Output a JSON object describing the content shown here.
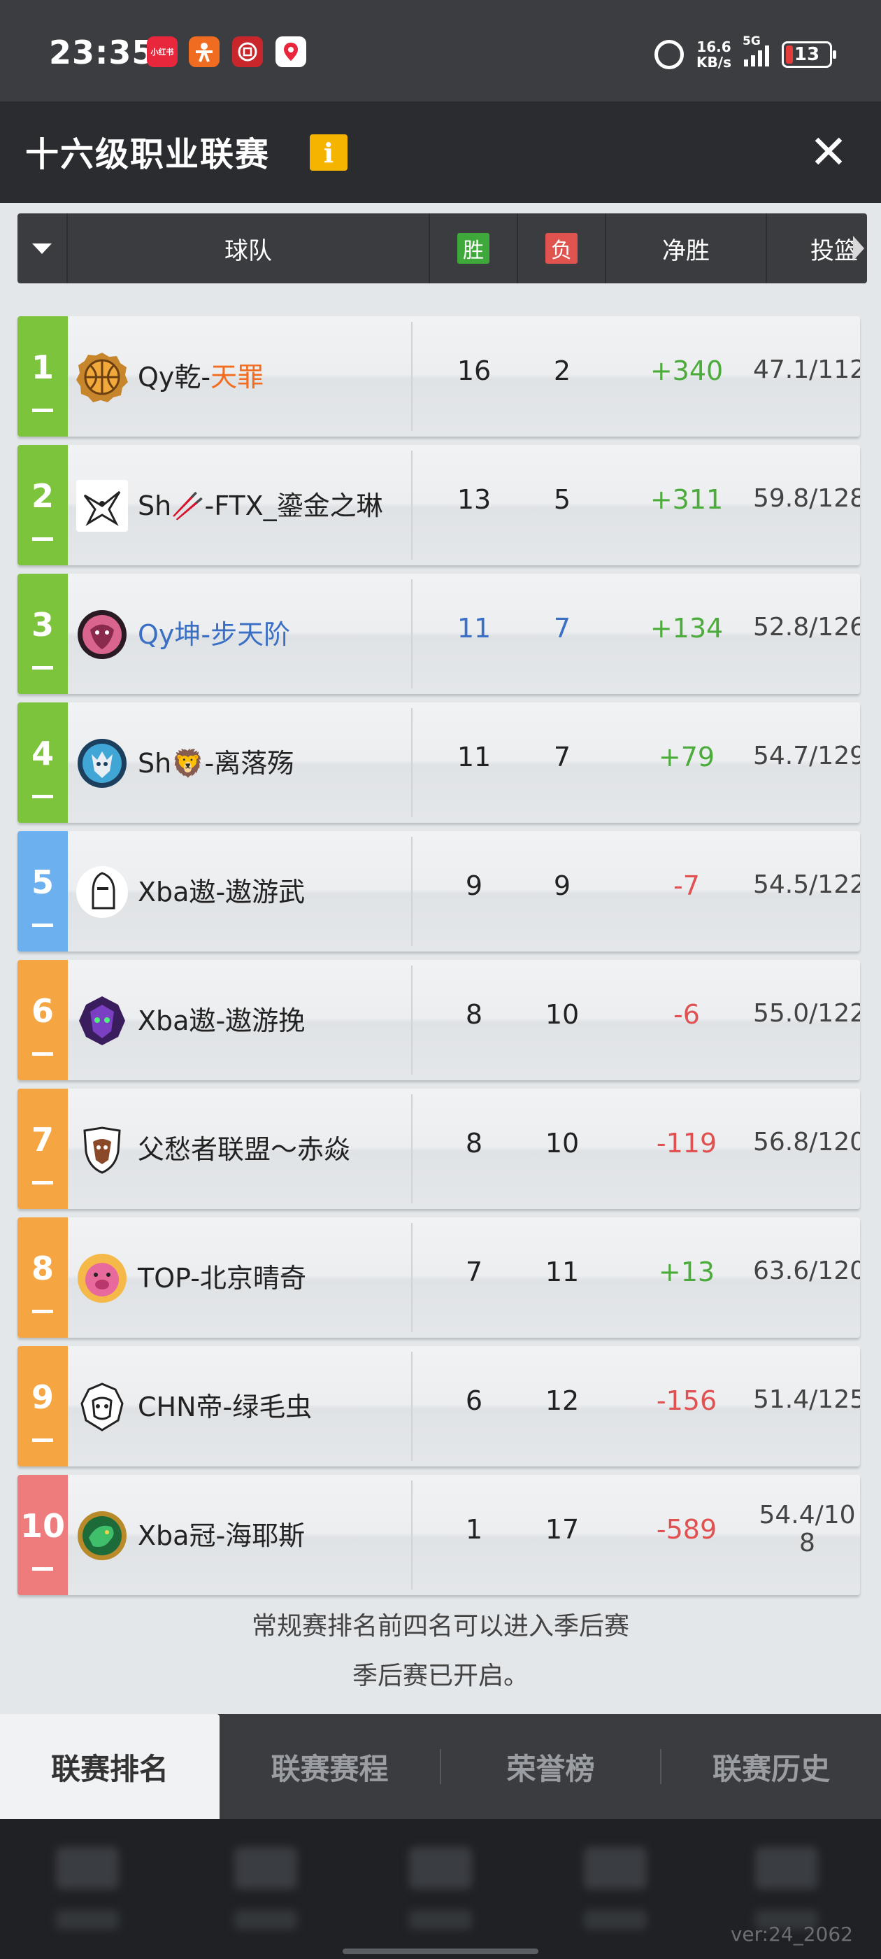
{
  "status_bar": {
    "time": "23:35",
    "apps": [
      {
        "icon": "xiaohongshu-icon",
        "label": "小红书",
        "color": "#e8263c"
      },
      {
        "icon": "figure-app-icon",
        "label": "",
        "color": "#f06c20"
      },
      {
        "icon": "bank-app-icon",
        "label": "",
        "color": "#c8262a"
      },
      {
        "icon": "map-pin-app-icon",
        "label": "",
        "color": "#ffffff"
      }
    ],
    "net_speed_value": "16.6",
    "net_speed_unit": "KB/s",
    "network": "5G",
    "battery": "13"
  },
  "title_bar": {
    "title": "十六级职业联赛",
    "info_label": "i",
    "close_label": "✕"
  },
  "table_header": {
    "team": "球队",
    "win": "胜",
    "lose": "负",
    "net": "净胜",
    "shot": "投篮"
  },
  "rows": [
    {
      "rank": "1",
      "name_prefix": "Qy乾-",
      "name_suffix": "天罪",
      "win": "16",
      "lose": "2",
      "net": "+340",
      "shot": "47.1/112",
      "logo": "basketball-badge-icon"
    },
    {
      "rank": "2",
      "name_prefix": "Sh🥢-FTX_鎏金之琳",
      "name_suffix": "",
      "win": "13",
      "lose": "5",
      "net": "+311",
      "shot": "59.8/128",
      "logo": "eagle-badge-icon"
    },
    {
      "rank": "3",
      "name_prefix": "Qy坤-步天阶",
      "name_suffix": "",
      "win": "11",
      "lose": "7",
      "net": "+134",
      "shot": "52.8/126",
      "logo": "beast-badge-icon"
    },
    {
      "rank": "4",
      "name_prefix": "Sh🦁-离落殇",
      "name_suffix": "",
      "win": "11",
      "lose": "7",
      "net": "+79",
      "shot": "54.7/129",
      "logo": "wolf-badge-icon"
    },
    {
      "rank": "5",
      "name_prefix": "Xba遨-遨游武",
      "name_suffix": "",
      "win": "9",
      "lose": "9",
      "net": "-7",
      "shot": "54.5/122",
      "logo": "knight-badge-icon"
    },
    {
      "rank": "6",
      "name_prefix": "Xba遨-遨游挽",
      "name_suffix": "",
      "win": "8",
      "lose": "10",
      "net": "-6",
      "shot": "55.0/122",
      "logo": "monster-badge-icon"
    },
    {
      "rank": "7",
      "name_prefix": "父愁者联盟～赤焱",
      "name_suffix": "",
      "win": "8",
      "lose": "10",
      "net": "-119",
      "shot": "56.8/120",
      "logo": "bull-badge-icon"
    },
    {
      "rank": "8",
      "name_prefix": "TOP-北京晴奇",
      "name_suffix": "",
      "win": "7",
      "lose": "11",
      "net": "+13",
      "shot": "63.6/120",
      "logo": "pig-badge-icon"
    },
    {
      "rank": "9",
      "name_prefix": "CHN帝-绿毛虫",
      "name_suffix": "",
      "win": "6",
      "lose": "12",
      "net": "-156",
      "shot": "51.4/125",
      "logo": "gorilla-badge-icon"
    },
    {
      "rank": "10",
      "name_prefix": "Xba冠-海耶斯",
      "name_suffix": "",
      "win": "1",
      "lose": "17",
      "net": "-589",
      "shot": "54.4/108",
      "logo": "dragon-badge-icon"
    }
  ],
  "notes": {
    "line1": "常规赛排名前四名可以进入季后赛",
    "line2": "季后赛已开启。"
  },
  "tabs": {
    "standings": "联赛排名",
    "schedule": "联赛赛程",
    "honors": "荣誉榜",
    "history": "联赛历史"
  },
  "version": "ver:24_2062",
  "colors": {
    "playoff": "#7cc43b",
    "middle": "#6cb0ef",
    "lower": "#f6a543",
    "last": "#ef7c7c",
    "positive": "#4cac3b",
    "negative": "#e05252",
    "highlight": "#3a6fc4"
  }
}
